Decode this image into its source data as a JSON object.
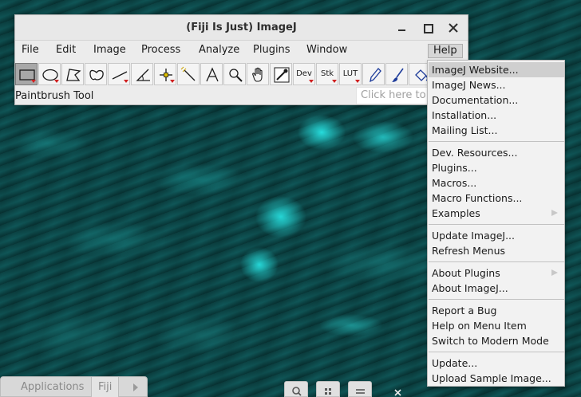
{
  "window": {
    "title": "(Fiji Is Just) ImageJ"
  },
  "menu_bar": [
    {
      "label": "File"
    },
    {
      "label": "Edit"
    },
    {
      "label": "Image"
    },
    {
      "label": "Process"
    },
    {
      "label": "Analyze"
    },
    {
      "label": "Plugins"
    },
    {
      "label": "Window"
    },
    {
      "label": "Help",
      "active": true
    }
  ],
  "toolbar": {
    "tools": [
      {
        "name": "rectangle-tool-icon",
        "selected": true
      },
      {
        "name": "oval-tool-icon"
      },
      {
        "name": "polygon-tool-icon"
      },
      {
        "name": "freehand-tool-icon"
      },
      {
        "name": "line-tool-icon"
      },
      {
        "name": "angle-tool-icon"
      },
      {
        "name": "point-tool-icon"
      },
      {
        "name": "wand-tool-icon"
      },
      {
        "name": "text-tool-icon"
      },
      {
        "name": "magnifier-tool-icon"
      },
      {
        "name": "hand-tool-icon"
      },
      {
        "name": "dropper-tool-icon"
      }
    ],
    "dev_label": "Dev",
    "stk_label": "Stk",
    "lut_label": "LUT",
    "status_text": "Paintbrush Tool",
    "search_placeholder": "Click here to search"
  },
  "help_menu": {
    "items": [
      {
        "label": "ImageJ Website...",
        "highlighted": true
      },
      {
        "label": "ImageJ News..."
      },
      {
        "label": "Documentation..."
      },
      {
        "label": "Installation..."
      },
      {
        "label": "Mailing List..."
      },
      {
        "label": "Dev. Resources..."
      },
      {
        "label": "Plugins..."
      },
      {
        "label": "Macros..."
      },
      {
        "label": "Macro Functions..."
      },
      {
        "label": "Examples",
        "submenu": true
      },
      {
        "label": "Update ImageJ..."
      },
      {
        "label": "Refresh Menus"
      },
      {
        "label": "About Plugins",
        "submenu": true
      },
      {
        "label": "About ImageJ..."
      },
      {
        "label": "Report a Bug"
      },
      {
        "label": "Help on Menu Item"
      },
      {
        "label": "Switch to Modern Mode"
      },
      {
        "label": "Update..."
      },
      {
        "label": "Upload Sample Image..."
      }
    ]
  },
  "taskbar": {
    "applications_label": "Applications",
    "fiji_label": "Fiji"
  },
  "colors": {
    "accent_cyan": "#28e6e6",
    "background_teal": "#0d4a4c",
    "menu_highlight": "#cfcfcf",
    "tool_arrow_red": "#d02020"
  }
}
